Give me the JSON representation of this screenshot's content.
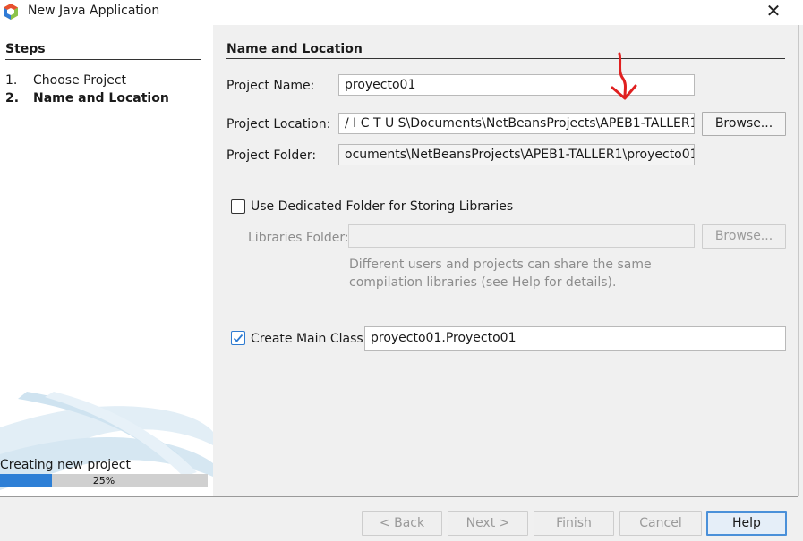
{
  "window": {
    "title": "New Java Application",
    "close_glyph": "✕"
  },
  "steps": {
    "heading": "Steps",
    "items": [
      {
        "num": "1.",
        "label": "Choose Project"
      },
      {
        "num": "2.",
        "label": "Name and Location"
      }
    ]
  },
  "progress": {
    "label": "Creating new project",
    "percent_text": "25%",
    "value": 0.25
  },
  "panel": {
    "heading": "Name and Location",
    "project_name_label": "Project Name:",
    "project_name_value": "proyecto01",
    "project_location_label": "Project Location:",
    "project_location_value": "/ I C T U S\\Documents\\NetBeansProjects\\APEB1-TALLER1",
    "project_folder_label": "Project Folder:",
    "project_folder_value": "ocuments\\NetBeansProjects\\APEB1-TALLER1\\proyecto01",
    "browse_label": "Browse...",
    "dedicated_folder_label": "Use Dedicated Folder for Storing Libraries",
    "dedicated_folder_checked": false,
    "libraries_folder_label": "Libraries Folder:",
    "libraries_folder_value": "",
    "libraries_browse_label": "Browse...",
    "hint_line1": "Different users and projects can share the same",
    "hint_line2": "compilation libraries (see Help for details).",
    "create_main_label": "Create Main Class",
    "create_main_checked": true,
    "main_class_value": "proyecto01.Proyecto01"
  },
  "footer": {
    "back_label": "< Back",
    "next_label": "Next >",
    "finish_label": "Finish",
    "cancel_label": "Cancel",
    "help_label": "Help"
  },
  "colors": {
    "accent": "#2d7fd6",
    "annotation": "#e02020"
  }
}
